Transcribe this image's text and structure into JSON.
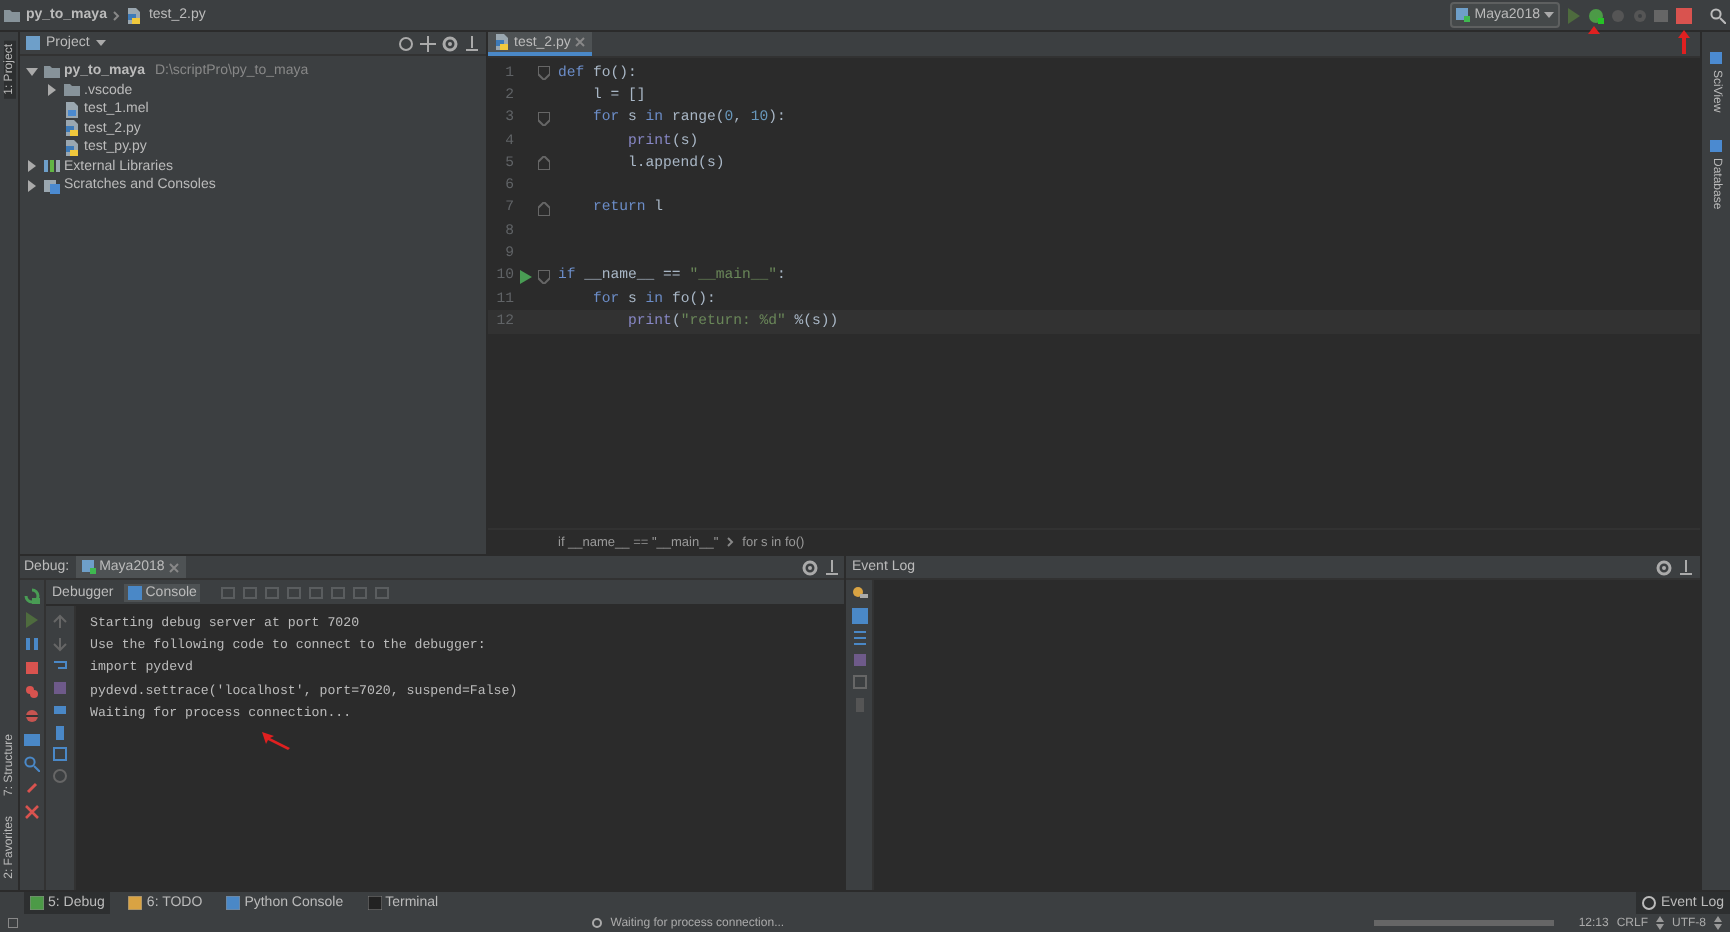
{
  "navbar": {
    "breadcrumbs": [
      "py_to_maya",
      "test_2.py"
    ],
    "run_config": "Maya2018"
  },
  "left_strip": {
    "tabs": [
      {
        "label": "1: Project",
        "selected": true
      },
      {
        "label": "7: Structure",
        "selected": false
      },
      {
        "label": "2: Favorites",
        "selected": false
      }
    ]
  },
  "right_strip": {
    "tabs": [
      "SciView",
      "Database"
    ]
  },
  "project": {
    "title": "Project",
    "tree": [
      {
        "label": "py_to_maya",
        "path": "D:\\scriptPro\\py_to_maya",
        "kind": "folder",
        "expanded": true,
        "children": [
          {
            "label": ".vscode",
            "kind": "folder",
            "expanded": false
          },
          {
            "label": "test_1.mel",
            "kind": "file"
          },
          {
            "label": "test_2.py",
            "kind": "python"
          },
          {
            "label": "test_py.py",
            "kind": "python"
          }
        ]
      },
      {
        "label": "External Libraries",
        "kind": "library",
        "expanded": false
      },
      {
        "label": "Scratches and Consoles",
        "kind": "scratch",
        "expanded": false
      }
    ]
  },
  "editor": {
    "tabs": [
      {
        "label": "test_2.py",
        "selected": true
      }
    ],
    "lines": [
      {
        "number": "1",
        "fold_start": true,
        "tokens": [
          {
            "text": "def",
            "kind": "kw"
          },
          {
            "text": " fo():",
            "kind": "txt"
          }
        ]
      },
      {
        "number": "2",
        "tokens": [
          {
            "text": "    l = []",
            "kind": "txt"
          }
        ]
      },
      {
        "number": "3",
        "fold_start": true,
        "tokens": [
          {
            "text": "    for",
            "kind": "kw"
          },
          {
            "text": " s ",
            "kind": "txt"
          },
          {
            "text": "in",
            "kind": "kw"
          },
          {
            "text": " range(",
            "kind": "txt"
          },
          {
            "text": "0",
            "kind": "num"
          },
          {
            "text": ", ",
            "kind": "txt"
          },
          {
            "text": "10",
            "kind": "num"
          },
          {
            "text": "):",
            "kind": "txt"
          }
        ]
      },
      {
        "number": "4",
        "tokens": [
          {
            "text": "        print",
            "kind": "builtin"
          },
          {
            "text": "(s)",
            "kind": "txt"
          }
        ]
      },
      {
        "number": "5",
        "fold_end": true,
        "tokens": [
          {
            "text": "        l.append(s)",
            "kind": "txt"
          }
        ]
      },
      {
        "number": "6"
      },
      {
        "number": "7",
        "fold_end": true,
        "tokens": [
          {
            "text": "    return",
            "kind": "kw"
          },
          {
            "text": " l",
            "kind": "txt"
          }
        ]
      },
      {
        "number": "8"
      },
      {
        "number": "9"
      },
      {
        "number": "10",
        "fold_start": true,
        "run": true,
        "tokens": [
          {
            "text": "if",
            "kind": "kw"
          },
          {
            "text": " __name__ == ",
            "kind": "txt"
          },
          {
            "text": "\"__main__\"",
            "kind": "str"
          },
          {
            "text": ":",
            "kind": "txt"
          }
        ]
      },
      {
        "number": "11",
        "tokens": [
          {
            "text": "    for",
            "kind": "kw"
          },
          {
            "text": " s ",
            "kind": "txt"
          },
          {
            "text": "in",
            "kind": "kw"
          },
          {
            "text": " fo():",
            "kind": "txt"
          }
        ]
      },
      {
        "number": "12",
        "current": true,
        "tokens": [
          {
            "text": "        print",
            "kind": "builtin"
          },
          {
            "text": "(",
            "kind": "txt"
          },
          {
            "text": "\"return: %d\"",
            "kind": "str"
          },
          {
            "text": " %(s))",
            "kind": "txt"
          }
        ]
      }
    ],
    "breadcrumb": [
      "if __name__ == \"__main__\"",
      "for s in fo()"
    ]
  },
  "debug": {
    "title": "Debug:",
    "session": "Maya2018",
    "tabs": [
      {
        "label": "Debugger",
        "selected": false
      },
      {
        "label": "Console",
        "selected": true
      }
    ],
    "console": [
      "Starting debug server at port 7020",
      "Use the following code to connect to the debugger:",
      "import pydevd",
      "pydevd.settrace('localhost', port=7020, suspend=False)",
      "Waiting for process connection..."
    ]
  },
  "event_log": {
    "title": "Event Log"
  },
  "tool_windows": [
    {
      "label": "5: Debug",
      "selected": true
    },
    {
      "label": "6: TODO",
      "selected": false
    },
    {
      "label": "Python Console",
      "selected": false
    },
    {
      "label": "Terminal",
      "selected": false
    }
  ],
  "event_log_button": "Event Log",
  "status_bar": {
    "message": "Waiting for process connection...",
    "position": "12:13",
    "progress": {
      "level": 1
    },
    "line_separator": "CRLF",
    "encoding": "UTF-8"
  }
}
